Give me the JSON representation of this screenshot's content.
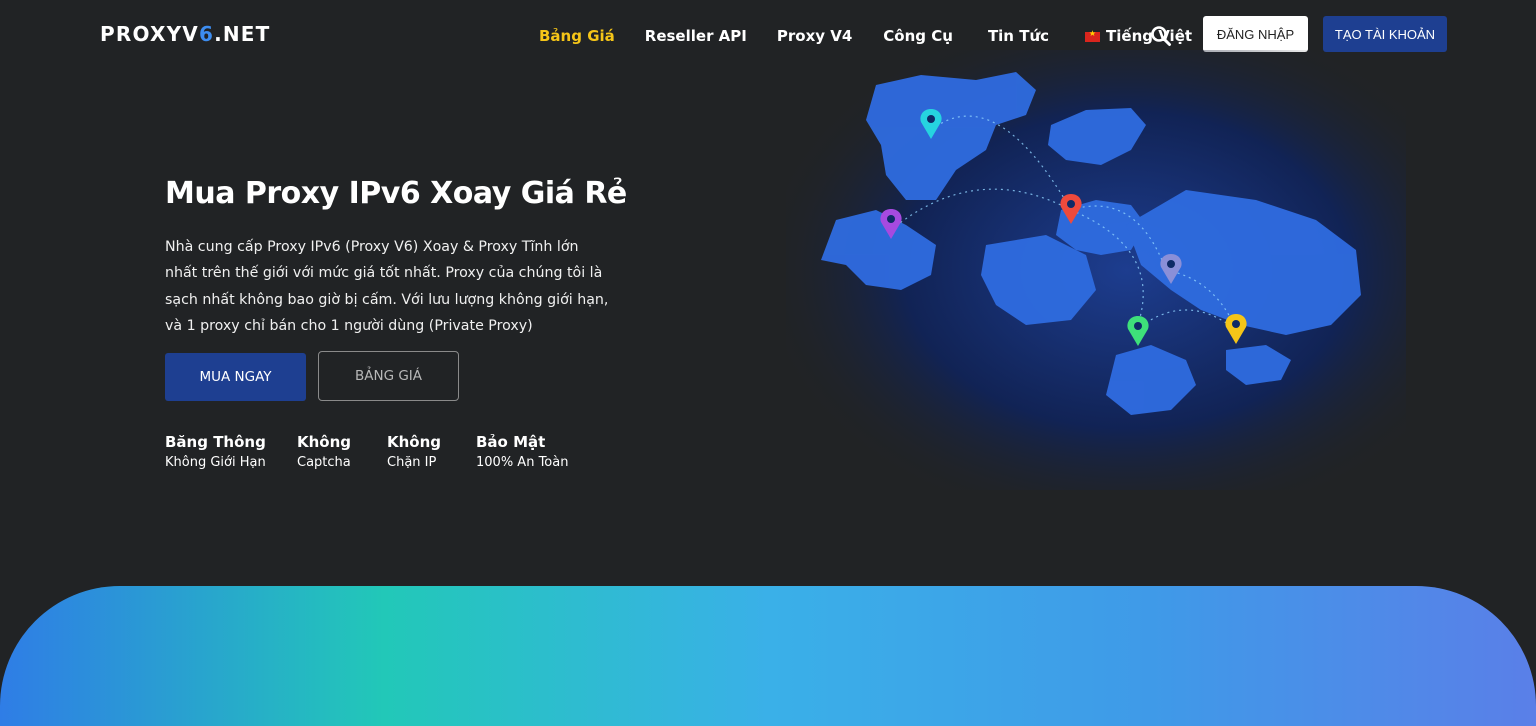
{
  "logo": {
    "part1": "PROXYV",
    "part2": "6",
    "part3": ".NET"
  },
  "nav": {
    "items": [
      "Bảng Giá",
      "Reseller API",
      "Proxy V4",
      "Công Cụ",
      "Tin Tức",
      "Tiếng Việt"
    ],
    "active_color": "#f5c518"
  },
  "header": {
    "login_label": "ĐĂNG NHẬP",
    "register_label": "TẠO TÀI KHOẢN"
  },
  "hero": {
    "title": "Mua Proxy IPv6 Xoay Giá Rẻ",
    "description": "Nhà cung cấp Proxy IPv6 (Proxy V6) Xoay & Proxy Tĩnh lớn nhất trên thế giới với mức giá tốt nhất. Proxy của chúng tôi là sạch nhất không bao giờ bị cấm. Với lưu lượng không giới hạn, và 1 proxy chỉ bán cho 1 người dùng (Private Proxy)",
    "buy_label": "MUA NGAY",
    "pricing_label": "BẢNG GIÁ"
  },
  "features": [
    {
      "title": "Băng Thông",
      "subtitle": "Không Giới Hạn"
    },
    {
      "title": "Không",
      "subtitle": "Captcha"
    },
    {
      "title": "Không",
      "subtitle": "Chặn IP"
    },
    {
      "title": "Bảo Mật",
      "subtitle": "100% An Toàn"
    }
  ],
  "icons": {
    "search": "search-icon",
    "flag": "vietnam-flag-icon",
    "map": "world-map-illustration"
  },
  "colors": {
    "background": "#212325",
    "primary": "#1e3f91",
    "accent": "#f5c518"
  }
}
